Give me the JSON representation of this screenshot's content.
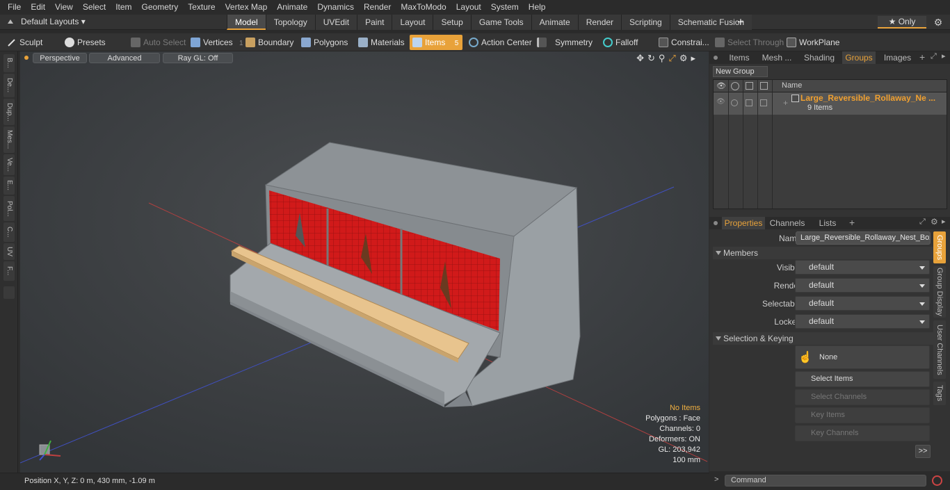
{
  "menu": [
    "File",
    "Edit",
    "View",
    "Select",
    "Item",
    "Geometry",
    "Texture",
    "Vertex Map",
    "Animate",
    "Dynamics",
    "Render",
    "MaxToModo",
    "Layout",
    "System",
    "Help"
  ],
  "layout_selector": "Default Layouts ▾",
  "mode_tabs": [
    {
      "label": "Model",
      "active": true
    },
    {
      "label": "Topology"
    },
    {
      "label": "UVEdit"
    },
    {
      "label": "Paint"
    },
    {
      "label": "Layout"
    },
    {
      "label": "Setup"
    },
    {
      "label": "Game Tools"
    },
    {
      "label": "Animate"
    },
    {
      "label": "Render"
    },
    {
      "label": "Scripting"
    },
    {
      "label": "Schematic Fusion"
    }
  ],
  "only_button": "★ Only",
  "toolbar": {
    "sculpt": "Sculpt",
    "presets": "Presets",
    "auto_select": "Auto Select",
    "vertices": "Vertices",
    "vertices_count": "1",
    "boundary": "Boundary",
    "polygons": "Polygons",
    "materials": "Materials",
    "items": "Items",
    "items_count": "5",
    "action_center": "Action Center",
    "symmetry": "Symmetry",
    "falloff": "Falloff",
    "constraints": "Constrai...",
    "select_through": "Select Through",
    "workplane": "WorkPlane"
  },
  "left_tabs": [
    "B...",
    "De...",
    "Dup...",
    "Mes...",
    "Ve...",
    "E...",
    "Pol...",
    "C...",
    "UV",
    "F..."
  ],
  "viewport": {
    "view_mode": "Perspective",
    "shading": "Advanced",
    "raygl": "Ray GL: Off",
    "info": {
      "selection": "No Items",
      "polygons": "Polygons : Face",
      "channels": "Channels: 0",
      "deformers": "Deformers: ON",
      "gl": "GL: 203,942",
      "scale": "100 mm"
    }
  },
  "status": {
    "position": "Position X, Y, Z:   0 m, 430 mm, -1.09 m"
  },
  "top_panel_tabs": [
    "Items",
    "Mesh ...",
    "Shading",
    "Groups",
    "Images"
  ],
  "groups": {
    "new_group": "New Group",
    "header_name": "Name",
    "items": [
      {
        "name": "Large_Reversible_Rollaway_Ne ...",
        "count": "9 Items"
      }
    ]
  },
  "props_tabs": [
    "Properties",
    "Channels",
    "Lists"
  ],
  "properties": {
    "name_label": "Name",
    "name_value": "Large_Reversible_Rollaway_Nest_Box",
    "members": "Members",
    "visible_label": "Visible",
    "visible": "default",
    "render_label": "Render",
    "render": "default",
    "selectable_label": "Selectable",
    "selectable": "default",
    "locked_label": "Locked",
    "locked": "default",
    "sel_keying": "Selection & Keying",
    "none": "None",
    "select_items": "Select Items",
    "select_channels": "Select Channels",
    "key_items": "Key Items",
    "key_channels": "Key Channels",
    "more": ">>"
  },
  "right_vtabs": [
    "Groups",
    "Group Display",
    "User Channels",
    "Tags"
  ],
  "command_placeholder": "Command"
}
